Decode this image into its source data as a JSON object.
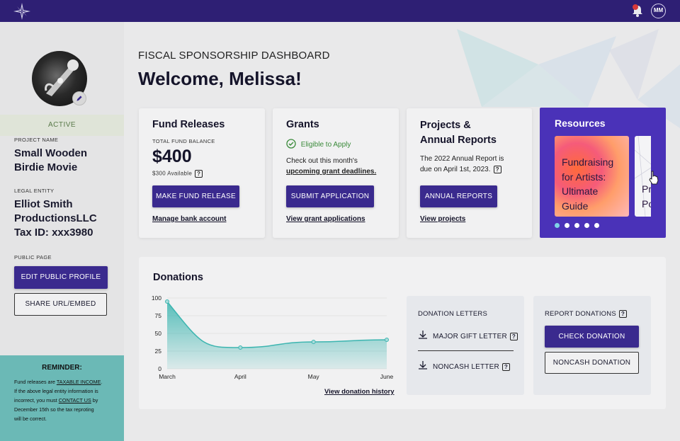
{
  "topbar": {
    "user_initials": "MM"
  },
  "sidebar": {
    "status": "ACTIVE",
    "project_name_label": "PROJECT NAME",
    "project_name": [
      "Small Wooden",
      "Birdie Movie"
    ],
    "legal_entity_label": "LEGAL ENTITY",
    "legal_entity": [
      "Elliot Smith",
      "ProductionsLLC",
      "Tax ID: xxx3980"
    ],
    "public_page_label": "PUBLIC PAGE",
    "edit_profile_button": "EDIT PUBLIC PROFILE",
    "share_button": "SHARE URL/EMBED",
    "reminder": {
      "title": "REMINDER:",
      "line1_pre": "Fund releases are ",
      "line1_link": "TAXABLE INCOME",
      "line1_post": ".",
      "line2": "If the above legal entity information is",
      "line3_pre": "incorrect, you must ",
      "line3_link": "CONTACT US",
      "line3_post": " by",
      "line4": "December 15th so the tax reproting",
      "line5": "will be correct."
    }
  },
  "header": {
    "eyebrow": "FISCAL SPONSORSHIP DASHBOARD",
    "welcome": "Welcome, Melissa!"
  },
  "fund_releases": {
    "title": "Fund Releases",
    "balance_label": "TOTAL FUND BALANCE",
    "balance": "$400",
    "available": "$300 Available",
    "button": "MAKE FUND RELEASE",
    "link": "Manage bank account"
  },
  "grants": {
    "title": "Grants",
    "eligible": "Eligible to Apply",
    "text_line1": "Check out this month's",
    "text_link": "upcoming grant deadlines.",
    "button": "SUBMIT APPLICATION",
    "link": "View grant applications"
  },
  "projects": {
    "title_line1": "Projects &",
    "title_line2": "Annual Reports",
    "text_line1": "The 2022 Annual Report is",
    "text_line2": "due on April 1st, 2023.",
    "button": "ANNUAL REPORTS",
    "link": "View projects"
  },
  "resources": {
    "title": "Resources",
    "card1": [
      "Fundraising",
      "for Artists:",
      "Ultimate",
      "Guide"
    ],
    "card2": [
      "Pr",
      "Po"
    ],
    "active_slide": 1,
    "slide_count": 5
  },
  "donations": {
    "title": "Donations",
    "history_link": "View donation history",
    "letters_label": "DONATION LETTERS",
    "major_gift": "MAJOR GIFT LETTER",
    "noncash_letter": "NONCASH LETTER",
    "report_label": "REPORT DONATIONS",
    "check_button": "CHECK DONATION",
    "noncash_button": "NONCASH DONATION"
  },
  "chart_data": {
    "type": "area",
    "categories": [
      "March",
      "April",
      "May",
      "June"
    ],
    "values": [
      95,
      30,
      38,
      41
    ],
    "yticks": [
      0,
      25,
      50,
      75,
      100
    ],
    "ylim": [
      0,
      100
    ],
    "grid": true,
    "color": "#3cb5b0"
  },
  "colors": {
    "primary": "#3a2a8e",
    "topbar": "#2e1f74",
    "resources_bg": "#4a32b8",
    "reminder_bg": "#6bb9b6",
    "eligible_green": "#3a8a3a"
  }
}
